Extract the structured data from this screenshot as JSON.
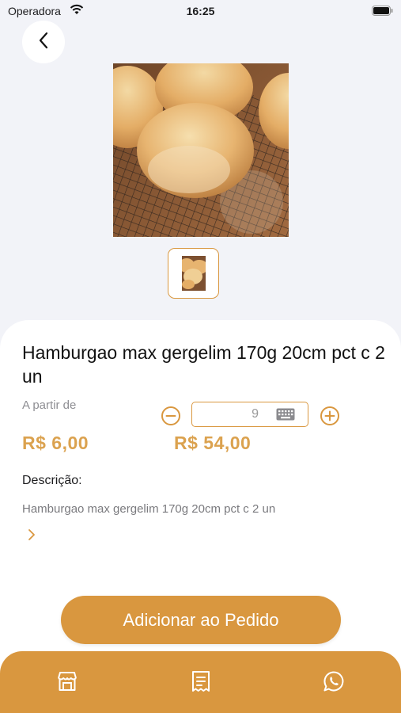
{
  "status_bar": {
    "carrier": "Operadora",
    "time": "16:25"
  },
  "product": {
    "name": "Hamburgao max  gergelim 170g 20cm pct c 2 un",
    "price_prefix": "A partir de",
    "unit_price": "R$ 6,00",
    "total_price": "R$ 54,00",
    "quantity": "9",
    "description_label": "Descrição:",
    "description": "Hamburgao max  gergelim 170g 20cm pct c 2 un"
  },
  "actions": {
    "add_to_order": "Adicionar ao Pedido"
  },
  "icons": {
    "back": "chevron-left-icon",
    "minus": "minus-circle-icon",
    "plus": "plus-circle-icon",
    "keyboard": "keyboard-icon",
    "expand": "chevron-right-icon",
    "tab_store": "store-icon",
    "tab_orders": "receipt-icon",
    "tab_whatsapp": "whatsapp-icon"
  },
  "colors": {
    "accent": "#d9973f",
    "price": "#dba24f",
    "background": "#f2f3f8"
  }
}
